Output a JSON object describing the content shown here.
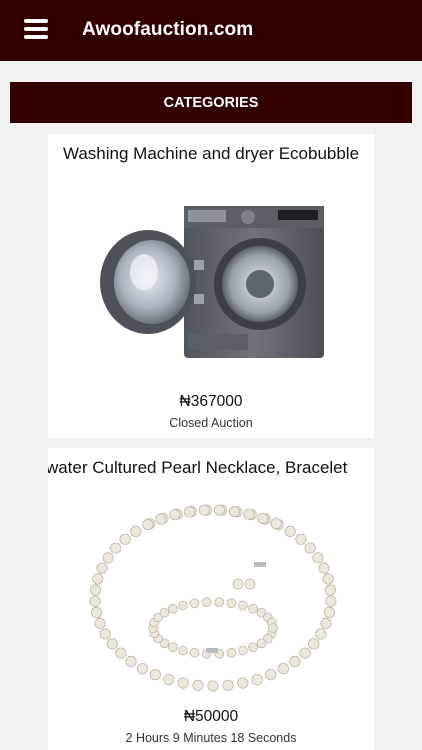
{
  "header": {
    "menu_icon": "hamburger-menu-icon",
    "title": "Awoofauction.com",
    "background_color": "#330000"
  },
  "categories_bar": {
    "label": "CATEGORIES"
  },
  "products": [
    {
      "title": "Washing Machine and dryer Ecobubble",
      "price": "₦367000",
      "status": "Closed Auction",
      "image": "washing-machine-image"
    },
    {
      "title": "shwater Cultured Pearl Necklace, Bracelet",
      "price": "₦50000",
      "status": "2 Hours 9 Minutes 18 Seconds",
      "image": "pearl-necklace-image"
    }
  ]
}
